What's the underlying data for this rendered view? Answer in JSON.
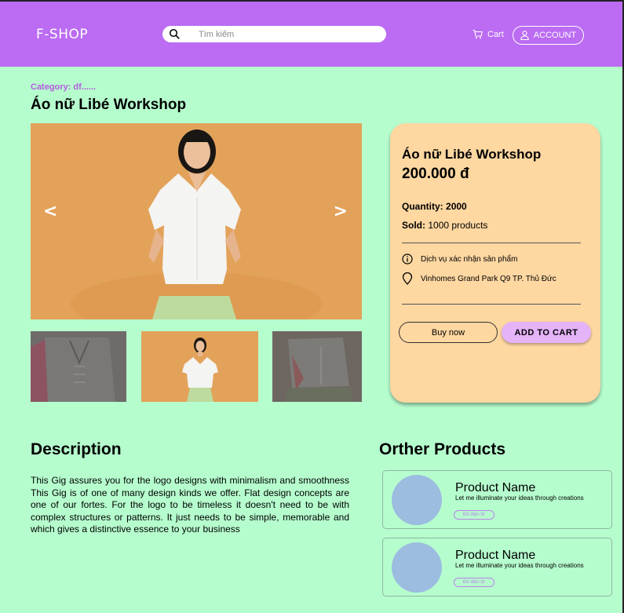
{
  "header": {
    "logo": "F-SHOP",
    "search_placeholder": "Tìm kiếm",
    "cart_label": "Cart",
    "account_label": "ACCOUNT",
    "background_color": "#bb6cf2"
  },
  "product": {
    "category": "Category: df......",
    "title": "Áo nữ Libé Workshop",
    "images": {
      "prev_arrow": "<",
      "next_arrow": ">"
    },
    "info": {
      "name": "Áo nữ Libé Workshop",
      "price": "200.000 đ",
      "quantity_label": "Quantity:",
      "quantity_value": "2000",
      "sold_label": "Sold:",
      "sold_value": "1000 products",
      "service": "Dịch vụ xác nhận sản phẩm",
      "location": "Vinhomes Grand Park Q9 TP. Thủ Đức",
      "buy_now": "Buy now",
      "add_to_cart": "ADD TO CART",
      "card_color": "#fed7a1"
    }
  },
  "description": {
    "title": "Description",
    "text": "This Gig assures you for the logo designs with minimalism and smoothness This Gig is of one of many design kinds we offer. Flat design concepts are one of our fortes. For the logo to be timeless it doesn't need to be with complex structures or patterns. It just needs to be simple, memorable and which gives a distinctive essence to your business"
  },
  "other_products": {
    "title": "Orther Products",
    "items": [
      {
        "name": "Product Name",
        "desc": "Let me illuminate your ideas through creations",
        "badge": "Đồ điện tử"
      },
      {
        "name": "Product Name",
        "desc": "Let me illuminate your ideas through creations",
        "badge": "Đồ điện tử"
      }
    ]
  },
  "colors": {
    "page_bg": "#b6fdce",
    "accent": "#bb6cf2",
    "button_cart": "#e4b3f8"
  }
}
